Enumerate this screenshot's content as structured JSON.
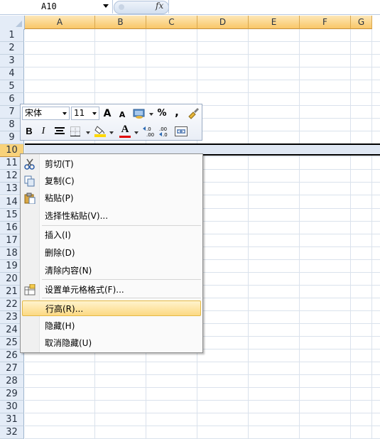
{
  "formula_bar": {
    "name_box": "A10",
    "fx_label": "fx"
  },
  "columns": [
    "A",
    "B",
    "C",
    "D",
    "E",
    "F",
    "G"
  ],
  "rows": [
    "1",
    "2",
    "3",
    "4",
    "5",
    "6",
    "7",
    "8",
    "9",
    "10",
    "11",
    "12",
    "13",
    "14",
    "15",
    "16",
    "17",
    "18",
    "19",
    "20",
    "21",
    "22",
    "23",
    "24",
    "25",
    "26",
    "27",
    "28",
    "29",
    "30",
    "31",
    "32"
  ],
  "selected_row": "10",
  "mini_toolbar": {
    "font_name": "宋体",
    "font_size": "11",
    "grow_font": "A",
    "shrink_font": "A",
    "percent": "%",
    "comma": ",",
    "bold": "B",
    "italic": "I",
    "font_color": "A",
    "inc_decimal": "←.0 .00",
    "dec_decimal": ".00 →.0",
    "accent_fill": "#ffd800",
    "accent_font": "#e00000"
  },
  "context_menu": {
    "items": [
      {
        "label": "剪切(T)",
        "icon": "scissors-icon"
      },
      {
        "label": "复制(C)",
        "icon": "copy-icon"
      },
      {
        "label": "粘贴(P)",
        "icon": "paste-icon"
      },
      {
        "label": "选择性粘贴(V)..."
      },
      {
        "label": "插入(I)"
      },
      {
        "label": "删除(D)"
      },
      {
        "label": "清除内容(N)"
      },
      {
        "label": "设置单元格格式(F)...",
        "icon": "format-cells-icon"
      },
      {
        "label": "行高(R)...",
        "highlighted": true
      },
      {
        "label": "隐藏(H)"
      },
      {
        "label": "取消隐藏(U)"
      }
    ]
  }
}
